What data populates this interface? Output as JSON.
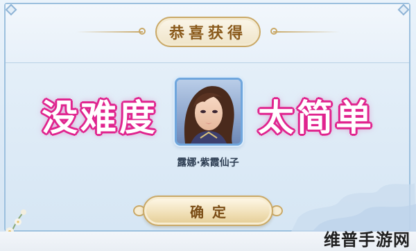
{
  "dialog": {
    "title": "恭喜获得",
    "caption_left": "没难度",
    "caption_right": "太简单",
    "item_name": "露娜·紫霞仙子",
    "item_icon": "hero-portrait-icon",
    "confirm_label": "确定"
  },
  "watermark": {
    "text": "维普手游网"
  },
  "colors": {
    "caption_stroke": "#e0258f",
    "gold_border": "#c9a866",
    "panel_blue": "#dbe9f6",
    "avatar_border": "#6fa6dd"
  }
}
